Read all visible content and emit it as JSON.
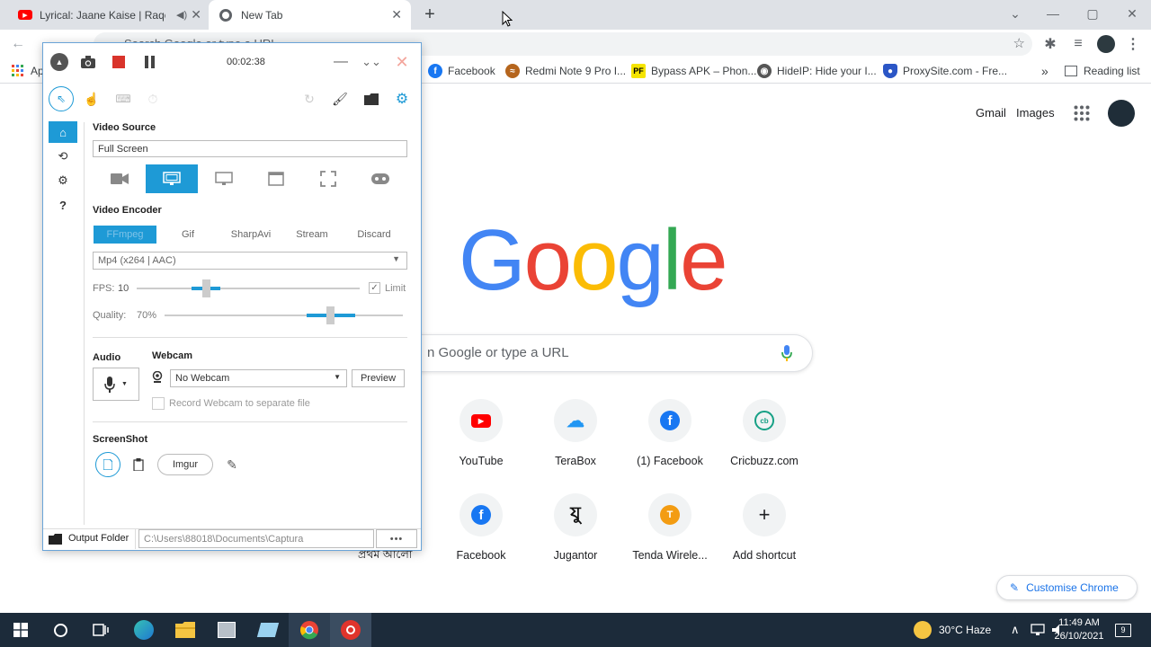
{
  "browser": {
    "tabs": [
      {
        "title": "Lyrical: Jaane Kaise | Raqeeb",
        "active": false
      },
      {
        "title": "New Tab",
        "active": true
      }
    ],
    "new_tab_symbol": "+",
    "omnibox_placeholder": "Search Google or type a URL",
    "bookmarks": [
      {
        "label": "Ap",
        "icon": "apps-grid-icon"
      },
      {
        "label": "Facebook",
        "icon": "facebook-icon"
      },
      {
        "label": "Redmi Note 9 Pro I...",
        "icon": "site-icon"
      },
      {
        "label": "Bypass APK – Phon...",
        "icon": "pf-icon"
      },
      {
        "label": "HideIP: Hide your I...",
        "icon": "hideip-icon"
      },
      {
        "label": "ProxySite.com - Fre...",
        "icon": "shield-icon"
      }
    ],
    "overflow": "»",
    "reading_list": "Reading list"
  },
  "ntp": {
    "gmail": "Gmail",
    "images": "Images",
    "logo": [
      "G",
      "o",
      "o",
      "g",
      "l",
      "e"
    ],
    "logo_colors": [
      "#4285f4",
      "#ea4335",
      "#fbbc05",
      "#4285f4",
      "#34a853",
      "#ea4335"
    ],
    "search_placeholder": "n Google or type a URL",
    "shortcuts": [
      {
        "label": "YouTube",
        "glyph": "▶",
        "color": "#ff0000"
      },
      {
        "label": "TeraBox",
        "glyph": "☁",
        "color": "#2196f3"
      },
      {
        "label": "(1) Facebook",
        "glyph": "f",
        "color": "#1877f2"
      },
      {
        "label": "Cricbuzz.com",
        "glyph": "cb",
        "color": "#16a085"
      },
      {
        "label": "Facebook",
        "glyph": "f",
        "color": "#1877f2"
      },
      {
        "label": "Jugantor",
        "glyph": "যু",
        "color": "#111111"
      },
      {
        "label": "Tenda Wirele...",
        "glyph": "T",
        "color": "#f39c12"
      },
      {
        "label": "Add shortcut",
        "glyph": "+",
        "color": "#202124"
      }
    ],
    "partial_label": "প্রথম আলো",
    "customise": "Customise Chrome"
  },
  "captura": {
    "timer": "00:02:38",
    "video_source_label": "Video Source",
    "video_source_value": "Full Screen",
    "video_encoder_label": "Video Encoder",
    "encoders": [
      "FFmpeg",
      "Gif",
      "SharpAvi",
      "Stream",
      "Discard"
    ],
    "codec": "Mp4 (x264 | AAC)",
    "fps_label": "FPS:",
    "fps_value": "10",
    "limit_label": "Limit",
    "quality_label": "Quality:",
    "quality_value": "70%",
    "audio_label": "Audio",
    "webcam_label": "Webcam",
    "webcam_value": "No Webcam",
    "preview_label": "Preview",
    "separate_file_label": "Record Webcam to separate file",
    "screenshot_label": "ScreenShot",
    "imgur_label": "Imgur",
    "output_folder_label": "Output Folder",
    "output_path": "C:\\Users\\88018\\Documents\\Captura",
    "more": "•••"
  },
  "taskbar": {
    "weather": "30°C  Haze",
    "time": "11:49 AM",
    "date": "26/10/2021",
    "notifications": "9"
  }
}
